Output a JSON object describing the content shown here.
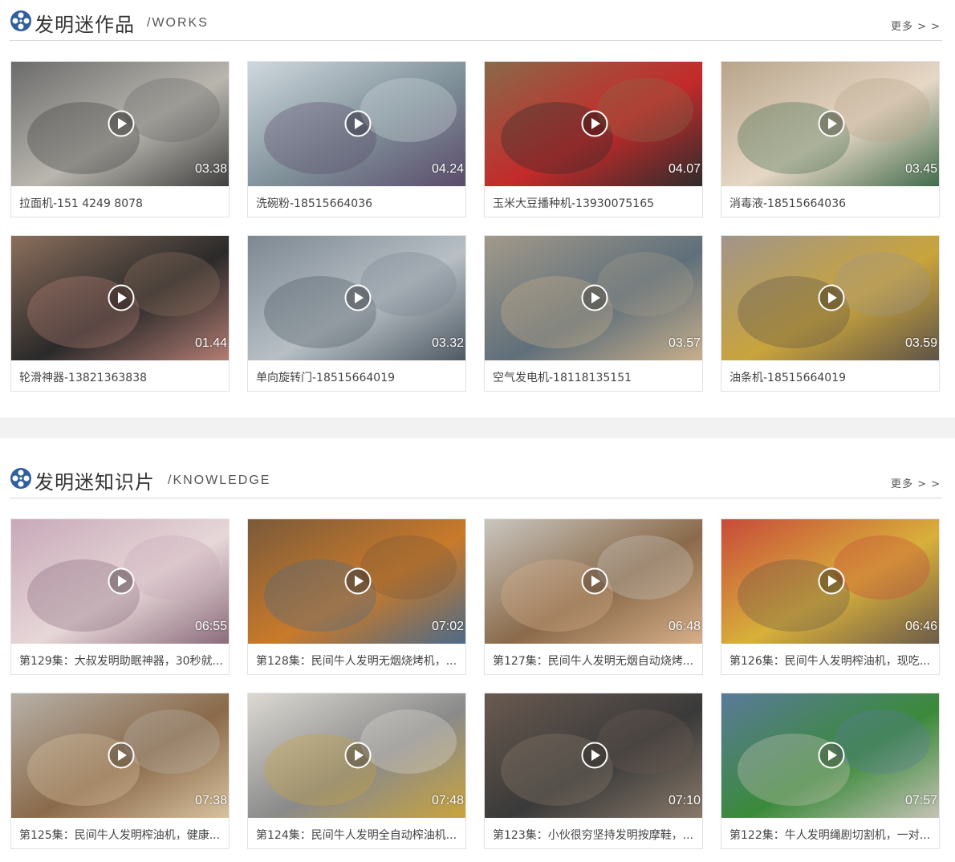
{
  "works": {
    "title": "发明迷作品",
    "subtitle": "/WORKS",
    "more_label": "更多 > >",
    "items": [
      {
        "title": "拉面机-151 4249 8078",
        "duration": "03.38",
        "colors": [
          "#6b6b6b",
          "#b9b6ae",
          "#3e3e3e"
        ]
      },
      {
        "title": "洗碗粉-18515664036",
        "duration": "04.24",
        "colors": [
          "#cfd8de",
          "#7e8f98",
          "#5b4a6b"
        ]
      },
      {
        "title": "玉米大豆播种机-13930075165",
        "duration": "04.07",
        "colors": [
          "#8a6a4a",
          "#c42a2a",
          "#2c2c2c"
        ]
      },
      {
        "title": "消毒液-18515664036",
        "duration": "03.45",
        "colors": [
          "#b7a48a",
          "#e6d7c5",
          "#3f6a4a"
        ]
      },
      {
        "title": "轮滑神器-13821363838",
        "duration": "01.44",
        "colors": [
          "#8c6f5c",
          "#2a2a2a",
          "#b57e74"
        ]
      },
      {
        "title": "单向旋转门-18515664019",
        "duration": "03.32",
        "colors": [
          "#7d8892",
          "#b7bfc5",
          "#4d5861"
        ]
      },
      {
        "title": "空气发电机-18118135151",
        "duration": "03.57",
        "colors": [
          "#a39a8a",
          "#5f6f7a",
          "#c9b08a"
        ]
      },
      {
        "title": "油条机-18515664019",
        "duration": "03.59",
        "colors": [
          "#a0958a",
          "#c9a43c",
          "#5c5248"
        ]
      }
    ]
  },
  "knowledge": {
    "title": "发明迷知识片",
    "subtitle": "/KNOWLEDGE",
    "more_label": "更多 > >",
    "items": [
      {
        "title": "第129集：大叔发明助眠神器，30秒就...",
        "duration": "06:55",
        "colors": [
          "#c8a8b8",
          "#e6d7d8",
          "#8a6a7a"
        ]
      },
      {
        "title": "第128集：民间牛人发明无烟烧烤机，...",
        "duration": "07:02",
        "colors": [
          "#7a5a3a",
          "#c97a2a",
          "#4a6a8a"
        ]
      },
      {
        "title": "第127集：民间牛人发明无烟自动烧烤...",
        "duration": "06:48",
        "colors": [
          "#c9c6bf",
          "#8a6a4a",
          "#d8b08a"
        ]
      },
      {
        "title": "第126集：民间牛人发明榨油机，现吃...",
        "duration": "06:46",
        "colors": [
          "#c84a3a",
          "#d8b03a",
          "#6a5a4a"
        ]
      },
      {
        "title": "第125集：民间牛人发明榨油机，健康...",
        "duration": "07:38",
        "colors": [
          "#b7b1a8",
          "#8a6a4a",
          "#d9c3a0"
        ]
      },
      {
        "title": "第124集：民间牛人发明全自动榨油机...",
        "duration": "07:48",
        "colors": [
          "#dcd9d2",
          "#8a8a8a",
          "#c9a43c"
        ]
      },
      {
        "title": "第123集：小伙很穷坚持发明按摩鞋，...",
        "duration": "07:10",
        "colors": [
          "#6a5a50",
          "#3a3a3a",
          "#8a7a6a"
        ]
      },
      {
        "title": "第122集：牛人发明绳剧切割机，一对...",
        "duration": "07:57",
        "colors": [
          "#5a7a9a",
          "#3a8a3a",
          "#c8c3b8"
        ]
      }
    ]
  }
}
